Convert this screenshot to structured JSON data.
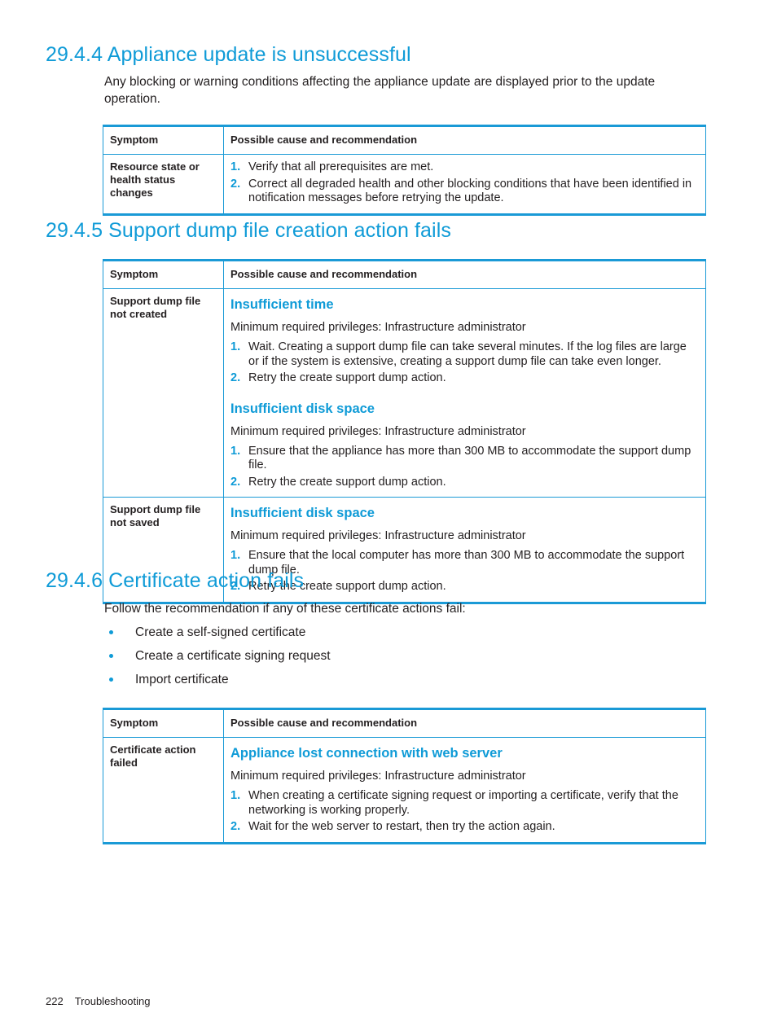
{
  "document": {
    "footer": {
      "page_number": "222",
      "chapter": "Troubleshooting"
    }
  },
  "table_headers": {
    "symptom": "Symptom",
    "cause": "Possible cause and recommendation"
  },
  "sections": [
    {
      "heading": "29.4.4 Appliance update is unsuccessful",
      "intro": "Any blocking or warning conditions affecting the appliance update are displayed prior to the update operation.",
      "table": {
        "rows": [
          {
            "symptom": "Resource state or health status changes",
            "blocks": [
              {
                "steps": [
                  "Verify that all prerequisites are met.",
                  "Correct all degraded health and other blocking conditions that have been identified in notification messages before retrying the update."
                ]
              }
            ]
          }
        ]
      }
    },
    {
      "heading": "29.4.5 Support dump file creation action fails",
      "table": {
        "rows": [
          {
            "symptom": "Support dump file not created",
            "blocks": [
              {
                "subhead": "Insufficient time",
                "note": "Minimum required privileges: Infrastructure administrator",
                "steps": [
                  "Wait. Creating a support dump file can take several minutes. If the log files are large or if the system is extensive, creating a support dump file can take even longer.",
                  "Retry the create support dump action."
                ]
              },
              {
                "subhead": "Insufficient disk space",
                "note": "Minimum required privileges: Infrastructure administrator",
                "steps": [
                  "Ensure that the appliance has more than 300 MB to accommodate the support dump file.",
                  "Retry the create support dump action."
                ]
              }
            ]
          },
          {
            "symptom": "Support dump file not saved",
            "blocks": [
              {
                "subhead": "Insufficient disk space",
                "note": "Minimum required privileges: Infrastructure administrator",
                "steps": [
                  "Ensure that the local computer has more than 300 MB to accommodate the support dump file.",
                  "Retry the create support dump action."
                ]
              }
            ]
          }
        ]
      }
    },
    {
      "heading": "29.4.6 Certificate action fails",
      "intro": "Follow the recommendation if any of these certificate actions fail:",
      "bullets": [
        "Create a self-signed certificate",
        "Create a certificate signing request",
        "Import certificate"
      ],
      "table": {
        "rows": [
          {
            "symptom": "Certificate action failed",
            "blocks": [
              {
                "subhead": "Appliance lost connection with web server",
                "note": "Minimum required privileges: Infrastructure administrator",
                "steps": [
                  "When creating a certificate signing request or importing a certificate, verify that the networking is working properly.",
                  "Wait for the web server to restart, then try the action again."
                ]
              }
            ]
          }
        ]
      }
    }
  ],
  "colors": {
    "accent_blue": "#0f9bd7",
    "table_border_blue": "#1a9ad6",
    "text_black": "#231f20"
  }
}
